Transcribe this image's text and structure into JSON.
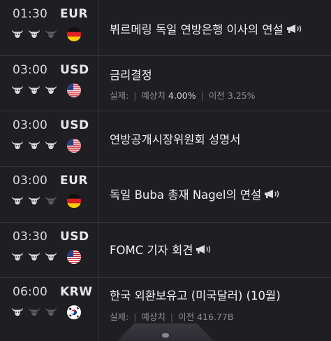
{
  "colors": {
    "background": "#1f1f23",
    "divider": "#34343a",
    "bull_on": "#d9d9dc",
    "bull_off": "#5b5b61"
  },
  "events": [
    {
      "time": "01:30",
      "currency": "EUR",
      "flag": "germany-flag-icon",
      "importance": 2,
      "title": "뷔르메링 독일 연방은행 이사의 연설",
      "speech": true,
      "actual_label": "",
      "forecast_label": "",
      "previous_label": ""
    },
    {
      "time": "03:00",
      "currency": "USD",
      "flag": "us-flag-icon",
      "importance": 3,
      "title": "금리결정",
      "speech": false,
      "actual_label": "실제:",
      "forecast_label": "예상치",
      "forecast_value": "4.00%",
      "previous_label": "이전",
      "previous_value": "3.25%"
    },
    {
      "time": "03:00",
      "currency": "USD",
      "flag": "us-flag-icon",
      "importance": 3,
      "title": "연방공개시장위원회 성명서",
      "speech": false,
      "actual_label": "",
      "forecast_label": "",
      "previous_label": ""
    },
    {
      "time": "03:00",
      "currency": "EUR",
      "flag": "germany-flag-icon",
      "importance": 2,
      "title": "독일 Buba 총재 Nagel의 연설",
      "speech": true,
      "actual_label": "",
      "forecast_label": "",
      "previous_label": ""
    },
    {
      "time": "03:30",
      "currency": "USD",
      "flag": "us-flag-icon",
      "importance": 3,
      "title": "FOMC 기자 회견",
      "speech": true,
      "actual_label": "",
      "forecast_label": "",
      "previous_label": ""
    },
    {
      "time": "06:00",
      "currency": "KRW",
      "flag": "south-korea-flag-icon",
      "importance": 1,
      "title": "한국 외환보유고 (미국달러) (10월)",
      "speech": false,
      "actual_label": "실제:",
      "forecast_label": "예상치",
      "previous_label": "이전",
      "previous_value": "416.77B"
    }
  ]
}
